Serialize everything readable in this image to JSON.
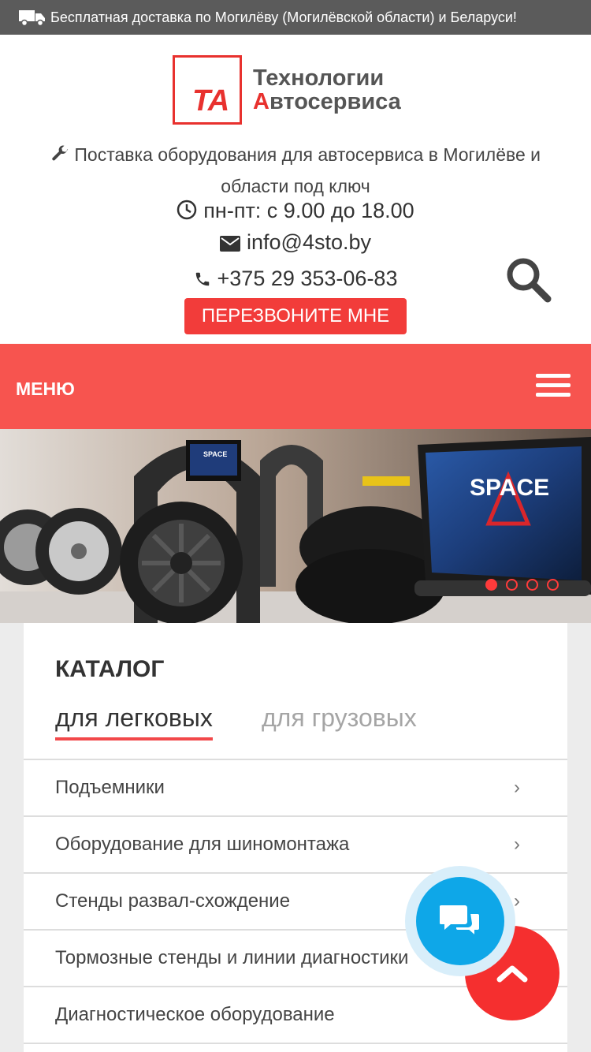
{
  "topbar": {
    "text": "Бесплатная доставка по Могилёву (Могилёвской области) и Беларуси!",
    "icon": "truck-icon"
  },
  "logo": {
    "mark": "ТА",
    "line1": "Технологии",
    "line2_first": "А",
    "line2_rest": "втосервиса"
  },
  "header": {
    "tagline_line1": "Поставка оборудования для автосервиса в Могилёве и",
    "tagline_line2": "области под ключ",
    "hours": "пн-пт: с 9.00 до 18.00",
    "email": "info@4sto.by",
    "phone": "+375 29 353-06-83",
    "callback_label": "ПЕРЕЗВОНИТЕ МНЕ"
  },
  "menu": {
    "label": "МЕНЮ"
  },
  "banner": {
    "screen_brand": "SPACE",
    "active_slide": 1,
    "slide_count": 4
  },
  "catalog": {
    "title": "КАТАЛОГ",
    "tabs": [
      {
        "label": "для легковых",
        "active": true
      },
      {
        "label": "для грузовых",
        "active": false
      }
    ],
    "items": [
      {
        "label": "Подъемники"
      },
      {
        "label": "Оборудование для шиномонтажа"
      },
      {
        "label": "Стенды развал-схождение"
      },
      {
        "label": "Тормозные стенды и линии диагностики"
      },
      {
        "label": "Диагностическое оборудование"
      }
    ],
    "chevron": "›"
  },
  "colors": {
    "accent": "#f7544f",
    "button": "#f23c3a",
    "chat": "#0ea7e8",
    "topbar": "#5b5b5b"
  }
}
